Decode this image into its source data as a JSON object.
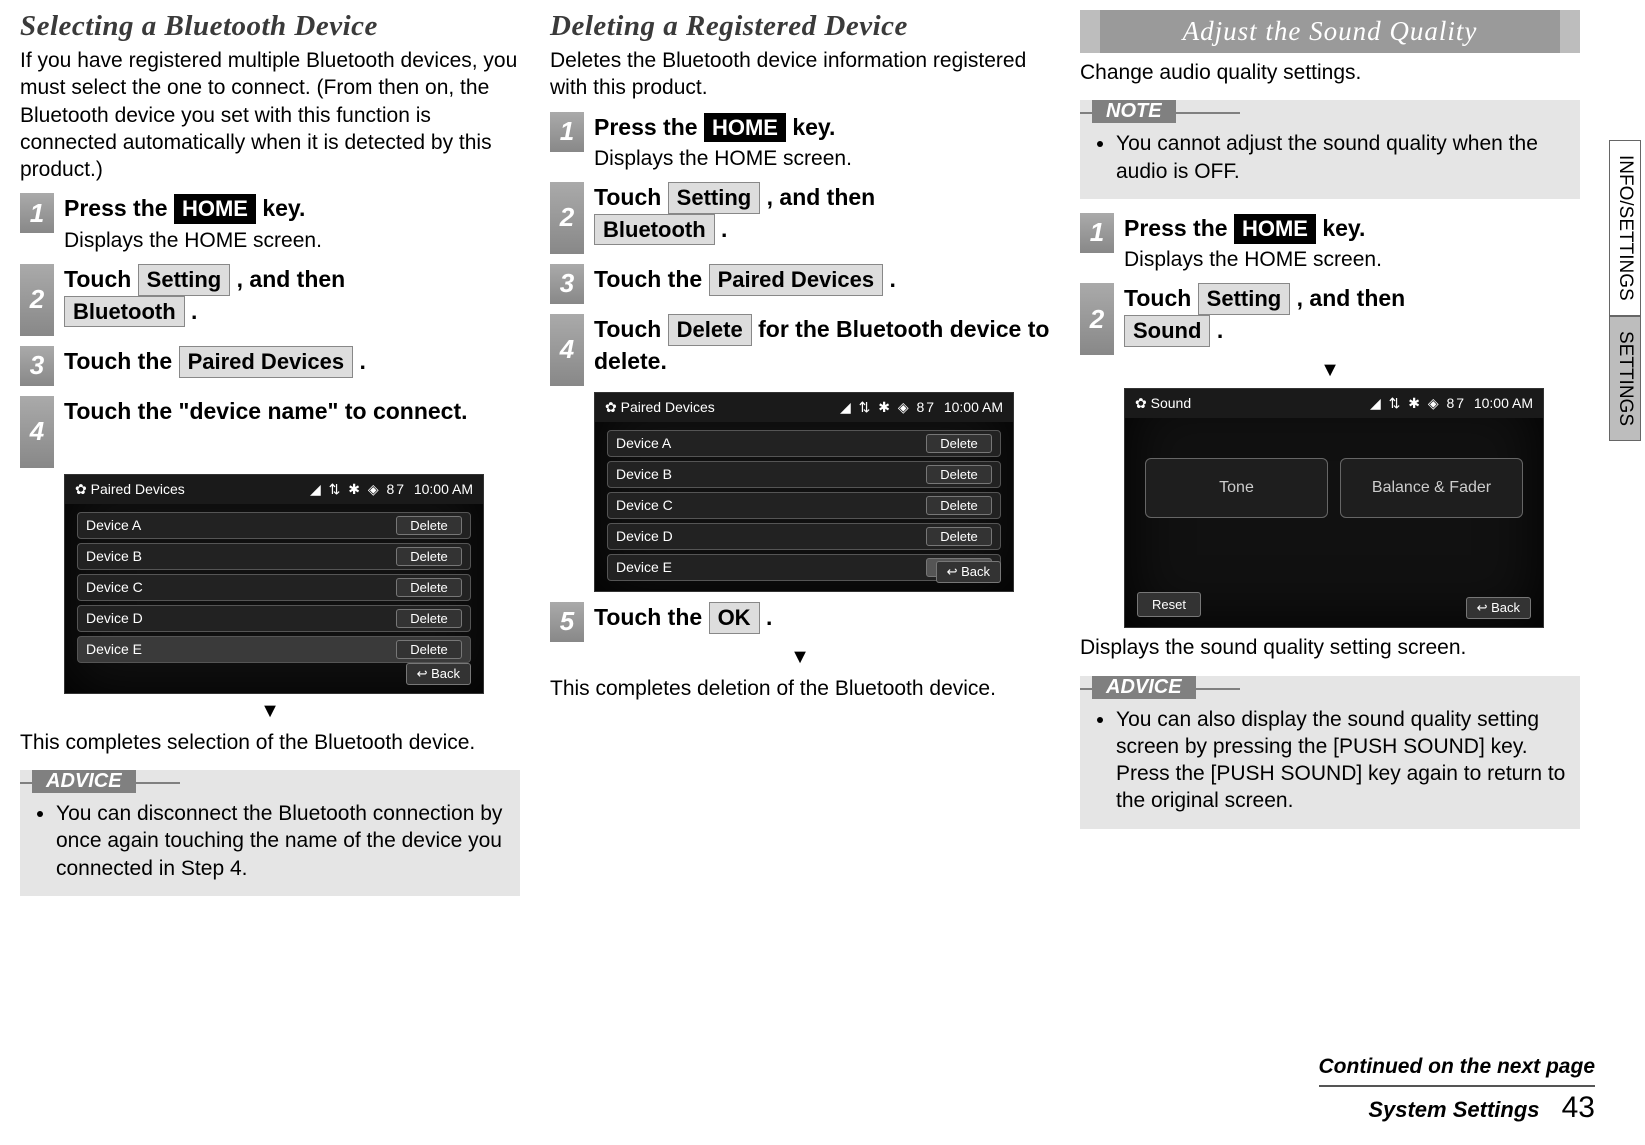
{
  "col1": {
    "heading": "Selecting a Bluetooth Device",
    "intro": "If you have registered multiple Bluetooth devices, you must select the one to connect. (From then on, the Bluetooth device you set with this function is connected automatically when it is detected by this product.)",
    "steps": [
      {
        "num": "1",
        "pre": "Press the ",
        "key": "HOME",
        "post": " key.",
        "desc": "Displays the HOME screen."
      },
      {
        "num": "2",
        "pre": "Touch ",
        "key": "Setting",
        "mid": " , and then ",
        "key2": "Bluetooth",
        "post2": " ."
      },
      {
        "num": "3",
        "pre": "Touch the ",
        "key": "Paired Devices",
        "post": " ."
      },
      {
        "num": "4",
        "title": "Touch the \"device name\" to connect."
      }
    ],
    "result": "This completes selection of the Bluetooth device.",
    "advice_label": "ADVICE",
    "advice": "You can disconnect the Bluetooth connection by once again touching the name of the device you connected in Step 4."
  },
  "col2": {
    "heading": "Deleting a Registered Device",
    "intro": "Deletes the Bluetooth device information registered with this product.",
    "steps": [
      {
        "num": "1",
        "pre": "Press the ",
        "key": "HOME",
        "post": " key.",
        "desc": "Displays the HOME screen."
      },
      {
        "num": "2",
        "pre": "Touch ",
        "key": "Setting",
        "mid": " , and then ",
        "key2": "Bluetooth",
        "post2": " ."
      },
      {
        "num": "3",
        "pre": "Touch the ",
        "key": "Paired Devices",
        "post": " ."
      },
      {
        "num": "4",
        "pre": "Touch ",
        "key": "Delete",
        "post": " for the Bluetooth device to delete."
      },
      {
        "num": "5",
        "pre": "Touch the ",
        "key": "OK",
        "post": " ."
      }
    ],
    "result": "This completes deletion of the Bluetooth device."
  },
  "col3": {
    "topbar": "Adjust the Sound Quality",
    "intro": "Change audio quality settings.",
    "note_label": "NOTE",
    "note": "You cannot adjust the sound quality when the audio is OFF.",
    "steps": [
      {
        "num": "1",
        "pre": "Press the ",
        "key": "HOME",
        "post": " key.",
        "desc": "Displays the HOME screen."
      },
      {
        "num": "2",
        "pre": "Touch ",
        "key": "Setting",
        "mid": " , and then ",
        "key2": "Sound",
        "post2": " ."
      }
    ],
    "result": "Displays the sound quality setting screen.",
    "advice_label": "ADVICE",
    "advice": "You can also display the sound quality setting screen by pressing the [PUSH SOUND] key.\nPress the [PUSH SOUND] key again to return to the original screen."
  },
  "screenshots": {
    "paired": {
      "title": "Paired Devices",
      "status": "◢ ⇅ ✱ ◈ 87",
      "time": "10:00 AM",
      "devices": [
        "Device A",
        "Device B",
        "Device C",
        "Device D",
        "Device E"
      ],
      "delete": "Delete",
      "back": "Back"
    },
    "sound": {
      "title": "Sound",
      "status": "◢ ⇅ ✱ ◈ 87",
      "time": "10:00 AM",
      "tone": "Tone",
      "balance": "Balance & Fader",
      "reset": "Reset",
      "back": "Back"
    }
  },
  "sidetabs": {
    "info": "INFO/SETTINGS",
    "settings": "SETTINGS"
  },
  "footer": {
    "continued": "Continued on the next page",
    "section": "System Settings",
    "page": "43"
  },
  "arrow": "▼"
}
